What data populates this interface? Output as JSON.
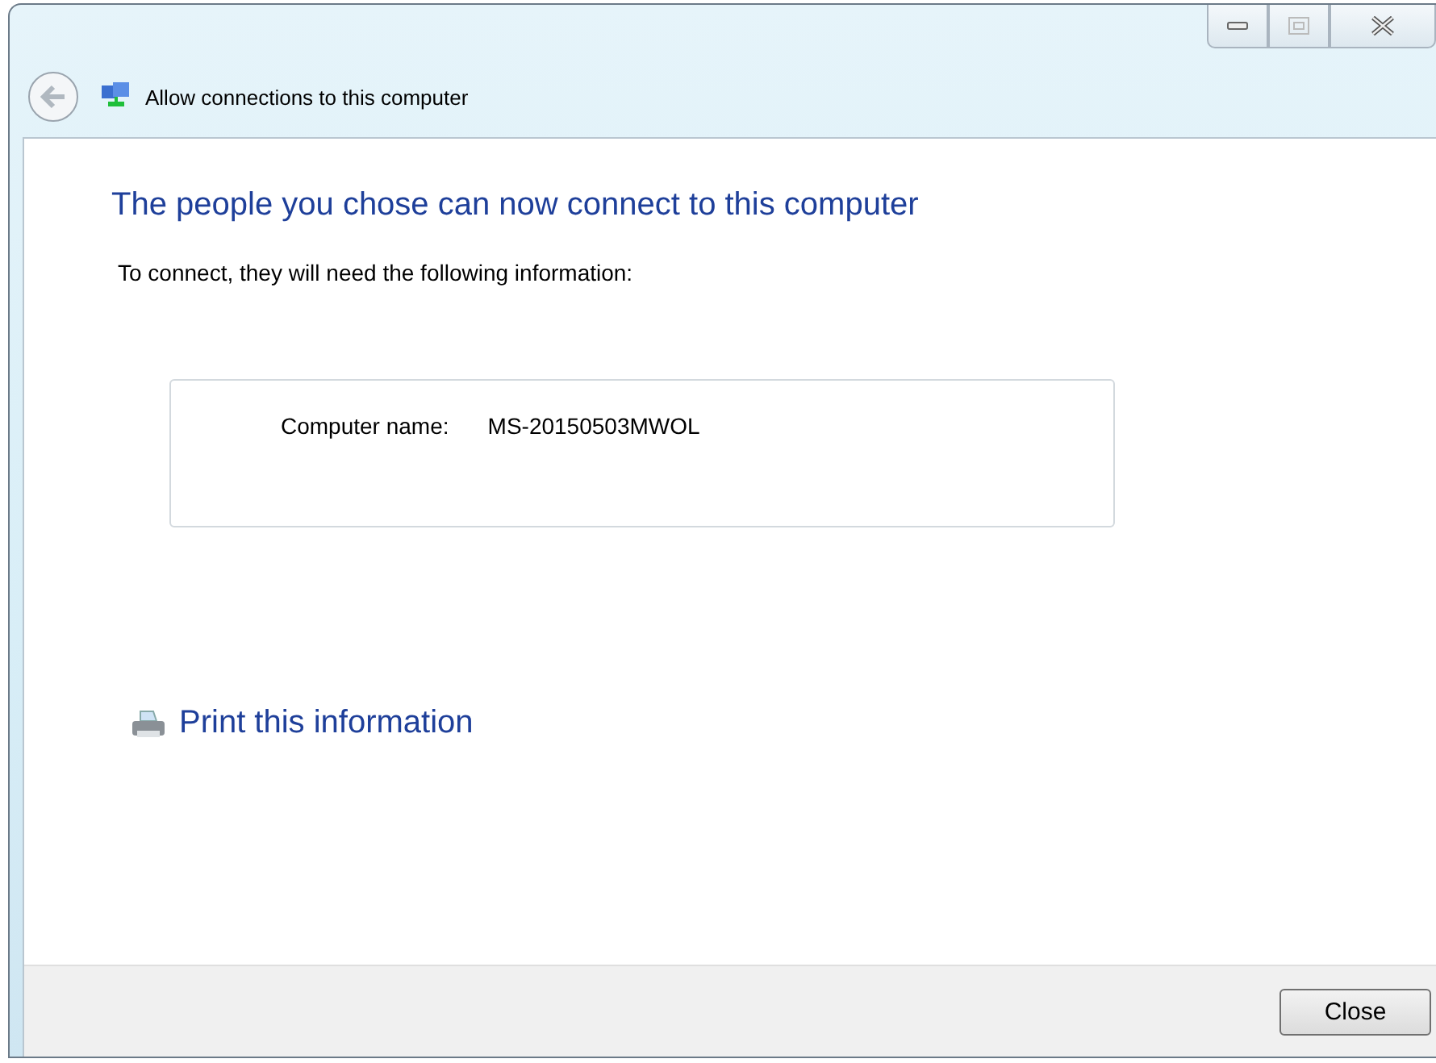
{
  "window": {
    "title": "Allow connections to this computer"
  },
  "heading": "The people you chose can now connect to this computer",
  "instruction": "To connect, they will need the following information:",
  "info": [
    {
      "label": "Computer name:",
      "value": "MS-20150503MWOL"
    }
  ],
  "print_link": "Print this information",
  "buttons": [
    "Close"
  ]
}
